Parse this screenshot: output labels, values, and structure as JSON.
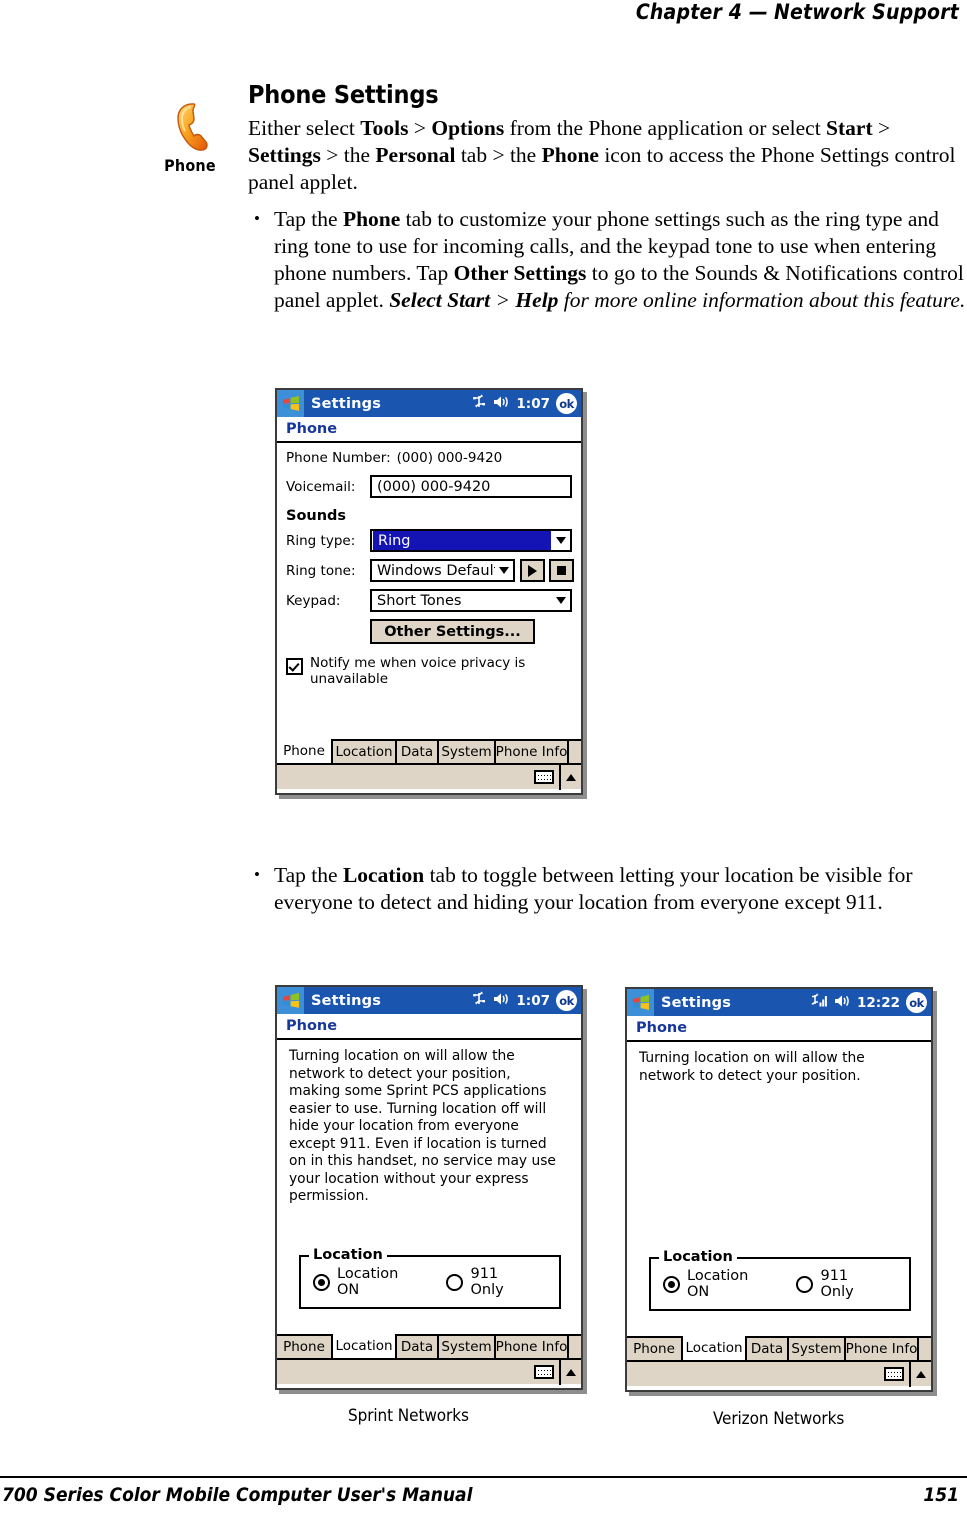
{
  "header": {
    "chapter": "Chapter  4  —",
    "title": "Network Support"
  },
  "icon": {
    "name": "phone-icon",
    "caption": "Phone"
  },
  "section": {
    "title": "Phone Settings",
    "intro_1": "Either select ",
    "intro_tools": "Tools",
    "intro_2": " > ",
    "intro_options": "Options",
    "intro_3": " from the Phone application or select ",
    "intro_start": "Start",
    "intro_4": " > ",
    "intro_settings": "Settings",
    "intro_5": " > the ",
    "intro_personal": "Personal",
    "intro_6": " tab > the ",
    "intro_phone": "Phone",
    "intro_7": " icon to access the Phone Settings control panel applet."
  },
  "bullet1": {
    "t1": "Tap the ",
    "b1": "Phone",
    "t2": " tab to customize your phone settings such as the ring type and ring tone to use for incoming calls, and the keypad tone to use when entering phone numbers. Tap ",
    "b2": "Other Settings",
    "t3": " to go to the Sounds & Notifications control panel applet. ",
    "i1": "Select Start",
    "i2": " > ",
    "i3": "Help",
    "i4": " for more online information about this feature."
  },
  "bullet2": {
    "t1": "Tap the ",
    "b1": "Location",
    "t2": " tab to toggle between letting your location be visible for everyone to detect and hiding your location from everyone except 911."
  },
  "screenshot_phone": {
    "titlebar": {
      "app": "Settings",
      "time": "1:07",
      "ok": "ok",
      "icons": [
        "windows-flag-icon",
        "connectivity-icon",
        "speaker-icon"
      ]
    },
    "subtitle": "Phone",
    "phone_number_label": "Phone Number:",
    "phone_number_value": "(000) 000-9420",
    "voicemail_label": "Voicemail:",
    "voicemail_value": "(000) 000-9420",
    "sounds_label": "Sounds",
    "ring_type_label": "Ring type:",
    "ring_type_value": "Ring",
    "ring_tone_label": "Ring tone:",
    "ring_tone_value": "Windows Default",
    "keypad_label": "Keypad:",
    "keypad_value": "Short Tones",
    "other_settings_button": "Other Settings...",
    "checkbox_label": "Notify me when voice privacy is unavailable",
    "checkbox_checked": true,
    "tabs": [
      "Phone",
      "Location",
      "Data",
      "System",
      "Phone Info"
    ],
    "active_tab": "Phone"
  },
  "screenshot_sprint": {
    "titlebar": {
      "app": "Settings",
      "time": "1:07",
      "ok": "ok",
      "icons": [
        "windows-flag-icon",
        "connectivity-icon",
        "speaker-icon"
      ]
    },
    "subtitle": "Phone",
    "body_text": "Turning location on will allow the\nnetwork to detect your position,\nmaking some Sprint PCS applications\neasier to use.  Turning location off will\nhide your location from everyone\nexcept 911.  Even if location is turned\non in this handset, no service may use\nyour location without your express\npermission.",
    "group_title": "Location",
    "radio_on_label": "Location ON",
    "radio_911_label": "911 Only",
    "selected_radio": "Location ON",
    "tabs": [
      "Phone",
      "Location",
      "Data",
      "System",
      "Phone Info"
    ],
    "active_tab": "Location",
    "caption": "Sprint Networks"
  },
  "screenshot_verizon": {
    "titlebar": {
      "app": "Settings",
      "time": "12:22",
      "ok": "ok",
      "icons": [
        "windows-flag-icon",
        "signal-bars-icon",
        "connectivity-icon",
        "speaker-icon"
      ]
    },
    "subtitle": "Phone",
    "body_text": "Turning location on will allow the\nnetwork to detect your position.",
    "group_title": "Location",
    "radio_on_label": "Location ON",
    "radio_911_label": "911 Only",
    "selected_radio": "Location ON",
    "tabs": [
      "Phone",
      "Location",
      "Data",
      "System",
      "Phone Info"
    ],
    "active_tab": "Location",
    "caption": "Verizon Networks"
  },
  "footer": {
    "left": "700 Series Color Mobile Computer User's Manual",
    "page": "151"
  },
  "colors": {
    "titlebar_blue": "#1a56b0",
    "subtitle_blue": "#17379c",
    "chrome_beige": "#ded5c6",
    "selection_blue": "#1414b4"
  }
}
